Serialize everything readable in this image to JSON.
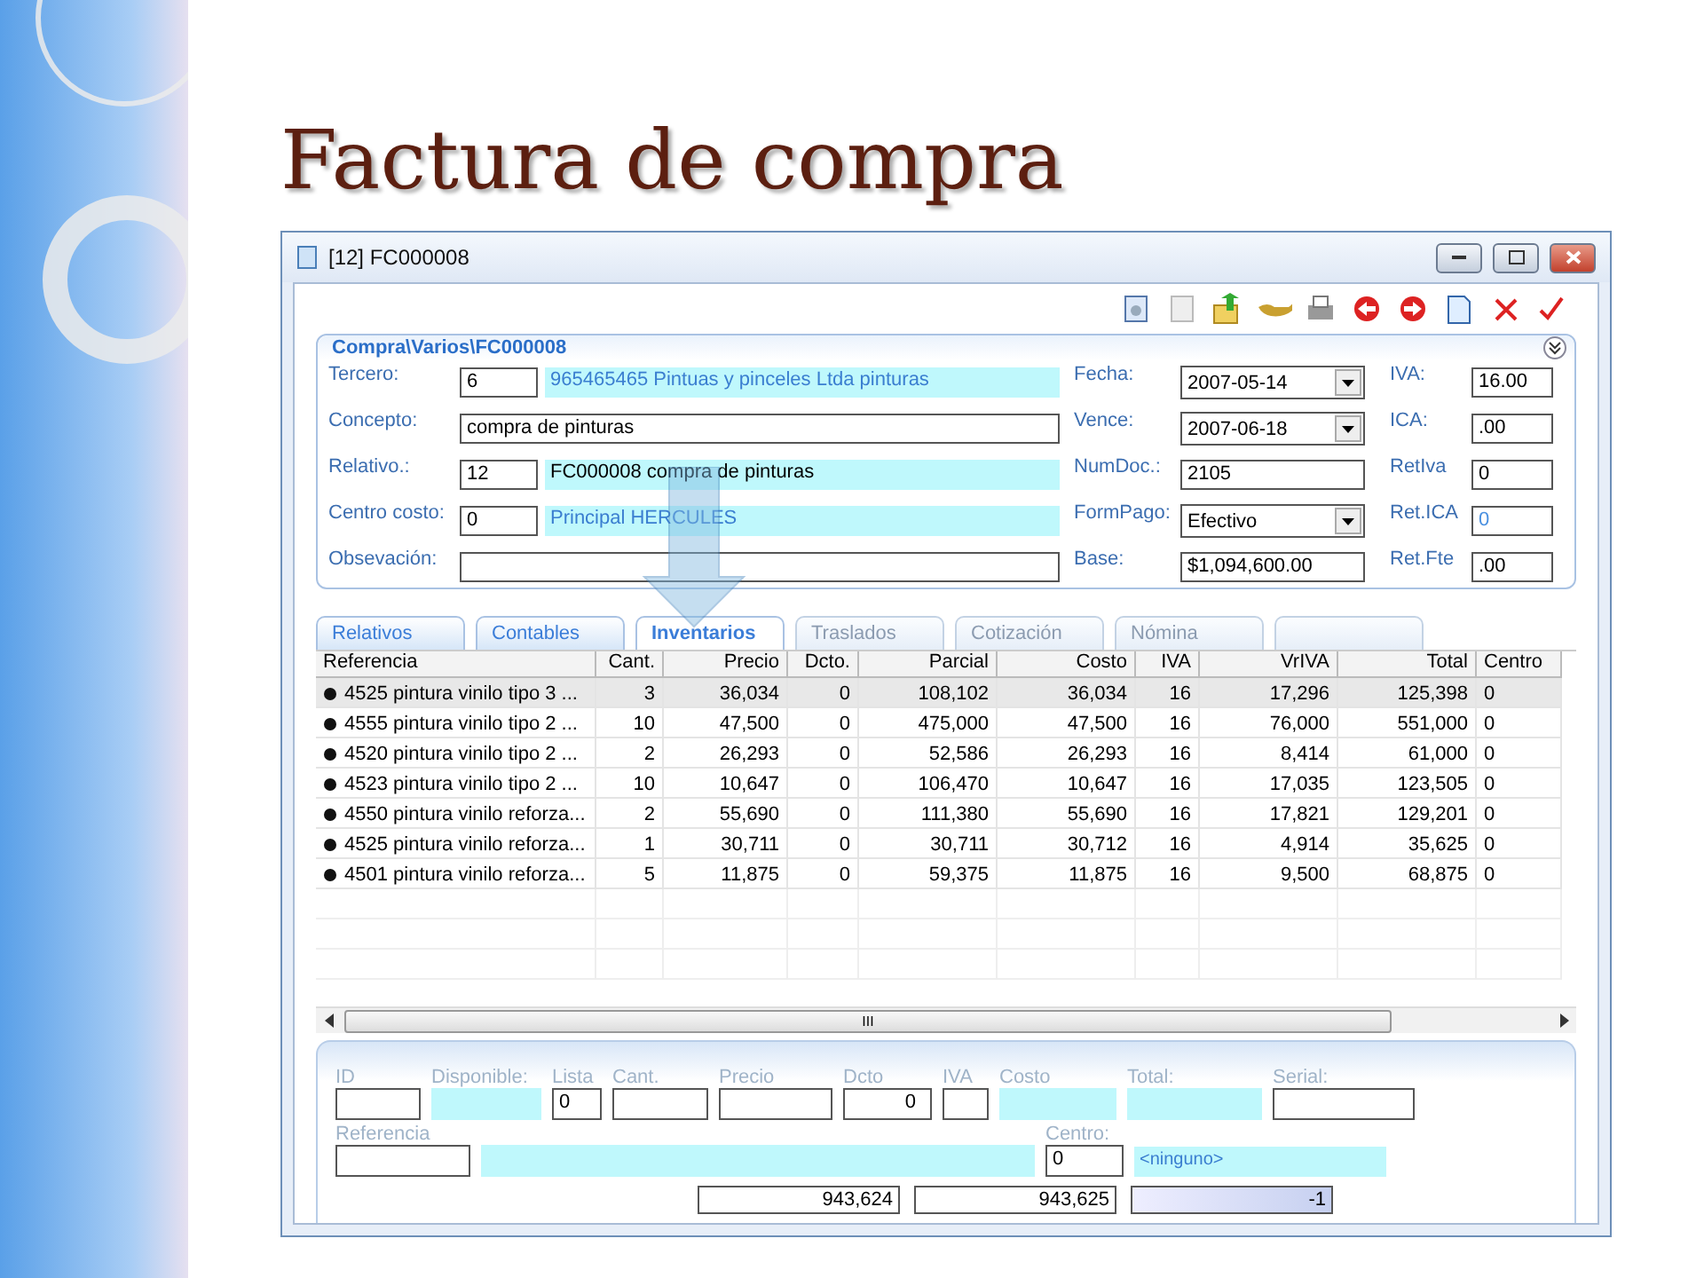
{
  "slide_title": "Factura de compra",
  "window": {
    "title": "[12] FC000008"
  },
  "panel": {
    "title": "Compra\\Varios\\FC000008",
    "left": [
      {
        "label": "Tercero:",
        "kind": "lookup",
        "code": "6",
        "value": "965465465 Pintuas y pinceles Ltda pinturas",
        "link": true
      },
      {
        "label": "Concepto:",
        "kind": "text",
        "value": "compra de pinturas"
      },
      {
        "label": "Relativo.:",
        "kind": "lookup",
        "code": "12",
        "value": "FC000008 compra de pinturas",
        "link": false
      },
      {
        "label": "Centro costo:",
        "kind": "lookup",
        "code": "0",
        "value": "Principal HERCULES",
        "link": true
      },
      {
        "label": "Obsevación:",
        "kind": "text"
      }
    ],
    "middle": [
      {
        "label": "Fecha:",
        "kind": "combo",
        "value": "2007-05-14"
      },
      {
        "label": "Vence:",
        "kind": "combo",
        "value": "2007-06-18"
      },
      {
        "label": "NumDoc.:",
        "kind": "text",
        "value": "2105"
      },
      {
        "label": "FormPago:",
        "kind": "combo",
        "value": "Efectivo"
      },
      {
        "label": "Base:",
        "kind": "text",
        "value": "$1,094,600.00"
      }
    ],
    "right": [
      {
        "label": "IVA:",
        "value": "16.00",
        "disabled": false
      },
      {
        "label": "ICA:",
        "value": ".00",
        "disabled": false
      },
      {
        "label": "RetIva",
        "value": "0",
        "disabled": false
      },
      {
        "label": "Ret.ICA",
        "value": "0",
        "disabled": true
      },
      {
        "label": "Ret.Fte",
        "value": ".00",
        "disabled": false
      }
    ]
  },
  "tabs": [
    {
      "label": "Relativos",
      "selected": false,
      "disabled": false
    },
    {
      "label": "Contables",
      "selected": false,
      "disabled": false
    },
    {
      "label": "Inventarios",
      "selected": true,
      "disabled": false
    },
    {
      "label": "Traslados",
      "selected": false,
      "disabled": true
    },
    {
      "label": "Cotización",
      "selected": false,
      "disabled": true
    },
    {
      "label": "Nómina",
      "selected": false,
      "disabled": true
    },
    {
      "selected": false,
      "disabled": true
    }
  ],
  "table": {
    "columns": [
      "Referencia",
      "Cant.",
      "Precio",
      "Dcto.",
      "Parcial",
      "Costo",
      "IVA",
      "VrIVA",
      "Total",
      "Centro"
    ],
    "rows": [
      {
        "selected": true,
        "cells": [
          "4525 pintura vinilo tipo 3 ...",
          "3",
          "36,034",
          "0",
          "108,102",
          "36,034",
          "16",
          "17,296",
          "125,398",
          "0"
        ]
      },
      {
        "selected": false,
        "cells": [
          "4555 pintura vinilo tipo 2 ...",
          "10",
          "47,500",
          "0",
          "475,000",
          "47,500",
          "16",
          "76,000",
          "551,000",
          "0"
        ]
      },
      {
        "selected": false,
        "cells": [
          "4520 pintura vinilo tipo 2  ...",
          "2",
          "26,293",
          "0",
          "52,586",
          "26,293",
          "16",
          "8,414",
          "61,000",
          "0"
        ]
      },
      {
        "selected": false,
        "cells": [
          "4523 pintura vinilo tipo 2 ...",
          "10",
          "10,647",
          "0",
          "106,470",
          "10,647",
          "16",
          "17,035",
          "123,505",
          "0"
        ]
      },
      {
        "selected": false,
        "cells": [
          "4550 pintura vinilo reforza...",
          "2",
          "55,690",
          "0",
          "111,380",
          "55,690",
          "16",
          "17,821",
          "129,201",
          "0"
        ]
      },
      {
        "selected": false,
        "cells": [
          "4525 pintura vinilo reforza...",
          "1",
          "30,711",
          "0",
          "30,711",
          "30,712",
          "16",
          "4,914",
          "35,625",
          "0"
        ]
      },
      {
        "selected": false,
        "cells": [
          "4501 pintura vinilo reforza...",
          "5",
          "11,875",
          "0",
          "59,375",
          "11,875",
          "16",
          "9,500",
          "68,875",
          "0"
        ]
      }
    ]
  },
  "scrollbar_grip": "III",
  "entry": {
    "fields": [
      {
        "label": "ID",
        "kind": "input"
      },
      {
        "label": "Disponible:",
        "kind": "readonly"
      },
      {
        "label": "Lista",
        "kind": "input",
        "value": "0"
      },
      {
        "label": "Cant.",
        "kind": "input"
      },
      {
        "label": "Precio",
        "kind": "input"
      },
      {
        "label": "Dcto",
        "kind": "number",
        "value": "0"
      },
      {
        "label": "IVA",
        "kind": "input"
      },
      {
        "label": "Costo",
        "kind": "readonly"
      },
      {
        "label": "Total:",
        "kind": "readonly"
      },
      {
        "label": "Serial:",
        "kind": "input"
      }
    ],
    "reference_label": "Referencia",
    "centro_label": "Centro:",
    "centro_code": "0",
    "centro_name": "<ninguno>",
    "totals": [
      "943,624",
      "943,625",
      "-1"
    ]
  }
}
